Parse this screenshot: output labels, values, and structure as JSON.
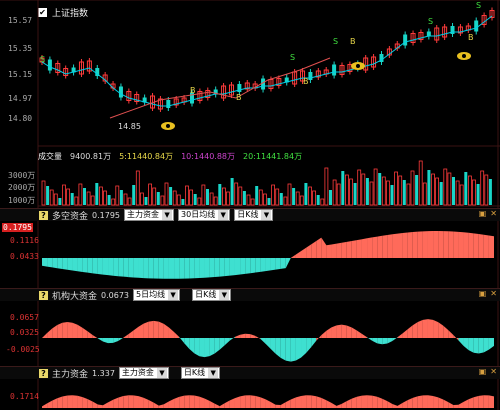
{
  "header": {
    "checkbox_label": "上证指数"
  },
  "price_axis": [
    "15.57",
    "15.35",
    "15.15",
    "14.97",
    "14.80"
  ],
  "price_low_label": "14.85",
  "volume_header": {
    "label": "成交量",
    "items": [
      {
        "text": "9400.81万",
        "color": "#dddddd"
      },
      {
        "text": "5:11440.84万",
        "color": "#e8d84a"
      },
      {
        "text": "10:1440.88万",
        "color": "#cc44cc"
      },
      {
        "text": "20:11441.84万",
        "color": "#40e040"
      }
    ]
  },
  "volume_axis": [
    "3000万",
    "2000万",
    "1000万"
  ],
  "panels": [
    {
      "title": "多空资金",
      "value": "0.1795",
      "selects": [
        "主力资金",
        "30日均线",
        "日K线"
      ],
      "axis": [
        "0.1795",
        "0.1116",
        "0.0433"
      ],
      "axis_highlight_top": true
    },
    {
      "title": "机构大资金",
      "value": "0.0673",
      "selects": [
        "5日均线",
        "日K线"
      ],
      "axis": [
        "0.0657",
        "0.0325",
        "-0.0025"
      ]
    },
    {
      "title": "主力资金",
      "value": "1.337",
      "selects": [
        "主力资金",
        "日K线"
      ],
      "axis": [
        "0.1714"
      ]
    }
  ],
  "colors": {
    "up": "#ff3b3b",
    "down": "#19d6c8",
    "ma": "#00d0e8",
    "fill_red": "#ff6a5a",
    "fill_cyan": "#3ee0d0"
  },
  "icons": [
    "checkbox-icon",
    "eye-icon",
    "help-icon",
    "settings-icon",
    "close-icon"
  ]
}
